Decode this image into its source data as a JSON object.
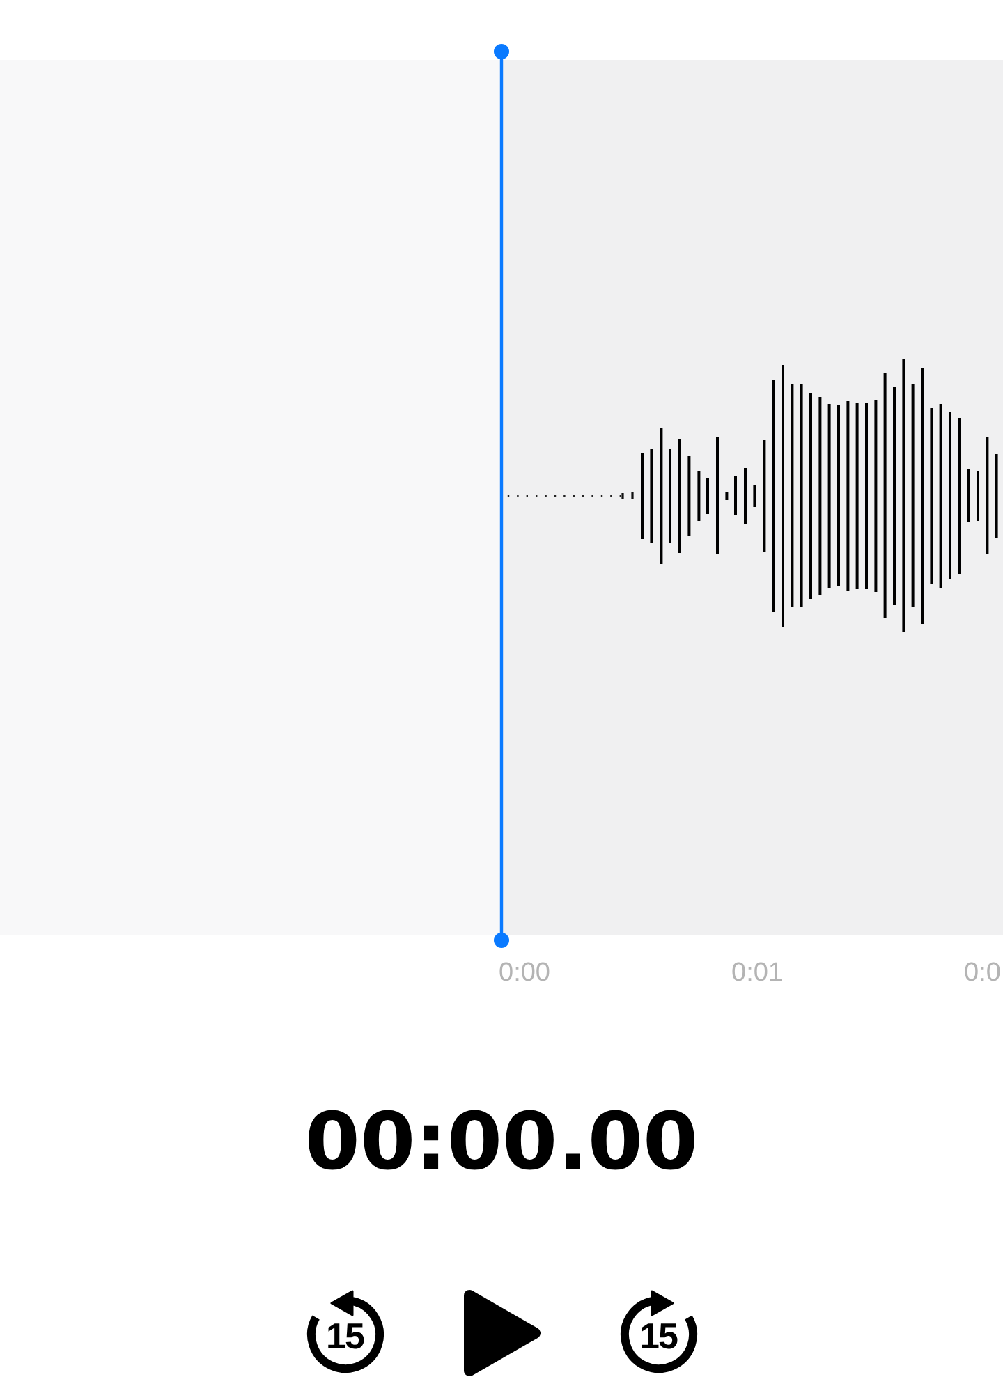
{
  "timeline": {
    "time_labels": [
      "0:00",
      "0:01",
      "0:0"
    ]
  },
  "timer": "00:00.00",
  "controls": [
    {
      "kind": "skip_back",
      "label": "15"
    },
    {
      "kind": "play"
    },
    {
      "kind": "skip_forward",
      "label": "15"
    }
  ]
}
